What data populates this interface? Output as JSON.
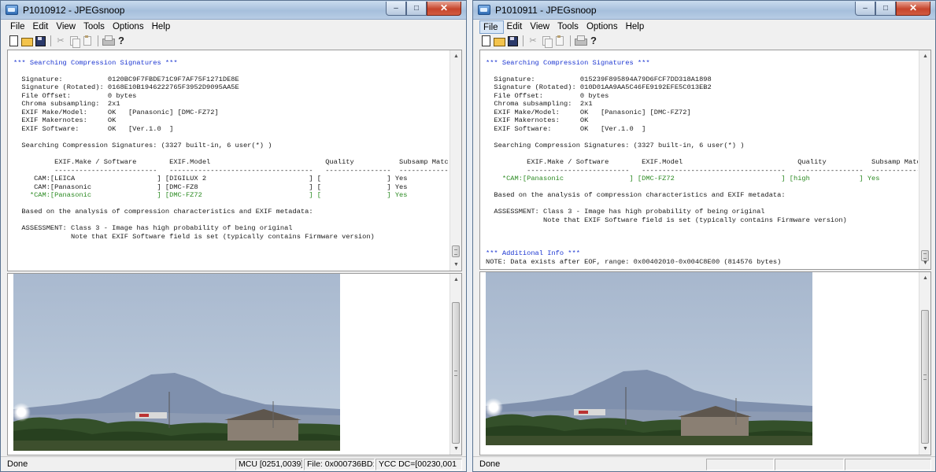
{
  "windows": [
    {
      "title": "P1010912 - JPEGsnoop",
      "controls": {
        "minimize": "–",
        "maximize": "□",
        "close": "✕"
      },
      "menu": [
        "File",
        "Edit",
        "View",
        "Tools",
        "Options",
        "Help"
      ],
      "toolbar_icons": [
        "new-icon",
        "open-icon",
        "save-icon",
        "cut-icon",
        "copy-icon",
        "paste-icon",
        "print-icon",
        "help-icon"
      ],
      "log": [
        {
          "t": "",
          "c": ""
        },
        {
          "t": "*** Searching Compression Signatures ***",
          "c": "blue"
        },
        {
          "t": "",
          "c": ""
        },
        {
          "t": "  Signature:           0120BC9F7FBDE71C9F7AF75F1271DE8E",
          "c": ""
        },
        {
          "t": "  Signature (Rotated): 0168E10B1946222765F3952D9095AA5E",
          "c": ""
        },
        {
          "t": "  File Offset:         0 bytes",
          "c": ""
        },
        {
          "t": "  Chroma subsampling:  2x1",
          "c": ""
        },
        {
          "t": "  EXIF Make/Model:     OK   [Panasonic] [DMC-FZ72]",
          "c": ""
        },
        {
          "t": "  EXIF Makernotes:     OK",
          "c": ""
        },
        {
          "t": "  EXIF Software:       OK   [Ver.1.0  ]",
          "c": ""
        },
        {
          "t": "",
          "c": ""
        },
        {
          "t": "  Searching Compression Signatures: (3327 built-in, 6 user(*) )",
          "c": ""
        },
        {
          "t": "",
          "c": ""
        },
        {
          "t": "          EXIF.Make / Software        EXIF.Model                            Quality           Subsamp Match?",
          "c": ""
        },
        {
          "t": "          -------------------------   -----------------------------------   ----------------  --------------",
          "c": ""
        },
        {
          "t": "     CAM:[LEICA                    ] [DIGILUX 2                         ] [                ] Yes",
          "c": ""
        },
        {
          "t": "     CAM:[Panasonic                ] [DMC-FZ8                           ] [                ] Yes",
          "c": ""
        },
        {
          "t": "    *CAM:[Panasonic                ] [DMC-FZ72                          ] [                ] Yes",
          "c": "green"
        },
        {
          "t": "",
          "c": ""
        },
        {
          "t": "  Based on the analysis of compression characteristics and EXIF metadata:",
          "c": ""
        },
        {
          "t": "",
          "c": ""
        },
        {
          "t": "  ASSESSMENT: Class 3 - Image has high probability of being original",
          "c": ""
        },
        {
          "t": "              Note that EXIF Software field is set (typically contains Firmware version)",
          "c": ""
        }
      ],
      "status": {
        "main": "Done",
        "panels": [
          "MCU [0251,0039]",
          "File: 0x000736BD:2",
          "YCC DC=[00230,001"
        ]
      }
    },
    {
      "title": "P1010911 - JPEGsnoop",
      "controls": {
        "minimize": "–",
        "maximize": "□",
        "close": "✕"
      },
      "menu": [
        "File",
        "Edit",
        "View",
        "Tools",
        "Options",
        "Help"
      ],
      "toolbar_icons": [
        "new-icon",
        "open-icon",
        "save-icon",
        "cut-icon",
        "copy-icon",
        "paste-icon",
        "print-icon",
        "help-icon"
      ],
      "log": [
        {
          "t": "",
          "c": ""
        },
        {
          "t": "*** Searching Compression Signatures ***",
          "c": "blue"
        },
        {
          "t": "",
          "c": ""
        },
        {
          "t": "  Signature:           015239F895894A79D6FCF7DD318A1898",
          "c": ""
        },
        {
          "t": "  Signature (Rotated): 010D01AA9AA5C46FE9192EFE5C013EB2",
          "c": ""
        },
        {
          "t": "  File Offset:         0 bytes",
          "c": ""
        },
        {
          "t": "  Chroma subsampling:  2x1",
          "c": ""
        },
        {
          "t": "  EXIF Make/Model:     OK   [Panasonic] [DMC-FZ72]",
          "c": ""
        },
        {
          "t": "  EXIF Makernotes:     OK",
          "c": ""
        },
        {
          "t": "  EXIF Software:       OK   [Ver.1.0  ]",
          "c": ""
        },
        {
          "t": "",
          "c": ""
        },
        {
          "t": "  Searching Compression Signatures: (3327 built-in, 6 user(*) )",
          "c": ""
        },
        {
          "t": "",
          "c": ""
        },
        {
          "t": "          EXIF.Make / Software        EXIF.Model                            Quality           Subsamp Match?",
          "c": ""
        },
        {
          "t": "          -------------------------   -----------------------------------   ----------------  --------------",
          "c": ""
        },
        {
          "t": "    *CAM:[Panasonic                ] [DMC-FZ72                          ] [high            ] Yes",
          "c": "green"
        },
        {
          "t": "",
          "c": ""
        },
        {
          "t": "  Based on the analysis of compression characteristics and EXIF metadata:",
          "c": ""
        },
        {
          "t": "",
          "c": ""
        },
        {
          "t": "  ASSESSMENT: Class 3 - Image has high probability of being original",
          "c": ""
        },
        {
          "t": "              Note that EXIF Software field is set (typically contains Firmware version)",
          "c": ""
        },
        {
          "t": "",
          "c": ""
        },
        {
          "t": "",
          "c": ""
        },
        {
          "t": "",
          "c": ""
        },
        {
          "t": "*** Additional Info ***",
          "c": "blue"
        },
        {
          "t": "NOTE: Data exists after EOF, range: 0x00402010-0x004C8E00 (814576 bytes)",
          "c": ""
        }
      ],
      "status": {
        "main": "Done",
        "panels": [
          "",
          "",
          ""
        ]
      }
    }
  ],
  "colors": {
    "log_blue": "#1c36d1",
    "log_green": "#2b8a22",
    "titlebar": "#b8cde5"
  }
}
